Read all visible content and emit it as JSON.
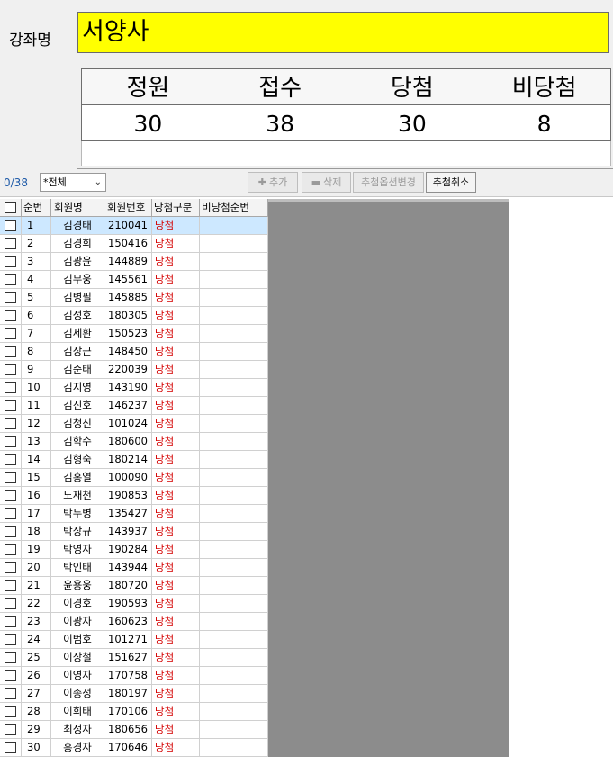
{
  "course": {
    "label": "강좌명",
    "name": "서양사"
  },
  "stats": {
    "headers": [
      "정원",
      "접수",
      "당첨",
      "비당첨"
    ],
    "values": [
      "30",
      "38",
      "30",
      "8"
    ]
  },
  "toolbar": {
    "count": "0/38",
    "filter_value": "*전체",
    "add_label": "추가",
    "delete_label": "삭제",
    "change_option_label": "추첨옵션변경",
    "cancel_draw_label": "추첨취소"
  },
  "table": {
    "columns": [
      "순번",
      "회원명",
      "회원번호",
      "당첨구분",
      "비당첨순번"
    ],
    "rows": [
      {
        "no": "1",
        "name": "김경태",
        "id": "210041",
        "status": "당첨",
        "rank": ""
      },
      {
        "no": "2",
        "name": "김경희",
        "id": "150416",
        "status": "당첨",
        "rank": ""
      },
      {
        "no": "3",
        "name": "김광윤",
        "id": "144889",
        "status": "당첨",
        "rank": ""
      },
      {
        "no": "4",
        "name": "김무웅",
        "id": "145561",
        "status": "당첨",
        "rank": ""
      },
      {
        "no": "5",
        "name": "김병필",
        "id": "145885",
        "status": "당첨",
        "rank": ""
      },
      {
        "no": "6",
        "name": "김성호",
        "id": "180305",
        "status": "당첨",
        "rank": ""
      },
      {
        "no": "7",
        "name": "김세환",
        "id": "150523",
        "status": "당첨",
        "rank": ""
      },
      {
        "no": "8",
        "name": "김장근",
        "id": "148450",
        "status": "당첨",
        "rank": ""
      },
      {
        "no": "9",
        "name": "김준태",
        "id": "220039",
        "status": "당첨",
        "rank": ""
      },
      {
        "no": "10",
        "name": "김지영",
        "id": "143190",
        "status": "당첨",
        "rank": ""
      },
      {
        "no": "11",
        "name": "김진호",
        "id": "146237",
        "status": "당첨",
        "rank": ""
      },
      {
        "no": "12",
        "name": "김청진",
        "id": "101024",
        "status": "당첨",
        "rank": ""
      },
      {
        "no": "13",
        "name": "김학수",
        "id": "180600",
        "status": "당첨",
        "rank": ""
      },
      {
        "no": "14",
        "name": "김형숙",
        "id": "180214",
        "status": "당첨",
        "rank": ""
      },
      {
        "no": "15",
        "name": "김홍열",
        "id": "100090",
        "status": "당첨",
        "rank": ""
      },
      {
        "no": "16",
        "name": "노재천",
        "id": "190853",
        "status": "당첨",
        "rank": ""
      },
      {
        "no": "17",
        "name": "박두병",
        "id": "135427",
        "status": "당첨",
        "rank": ""
      },
      {
        "no": "18",
        "name": "박상규",
        "id": "143937",
        "status": "당첨",
        "rank": ""
      },
      {
        "no": "19",
        "name": "박영자",
        "id": "190284",
        "status": "당첨",
        "rank": ""
      },
      {
        "no": "20",
        "name": "박인태",
        "id": "143944",
        "status": "당첨",
        "rank": ""
      },
      {
        "no": "21",
        "name": "윤용웅",
        "id": "180720",
        "status": "당첨",
        "rank": ""
      },
      {
        "no": "22",
        "name": "이경호",
        "id": "190593",
        "status": "당첨",
        "rank": ""
      },
      {
        "no": "23",
        "name": "이광자",
        "id": "160623",
        "status": "당첨",
        "rank": ""
      },
      {
        "no": "24",
        "name": "이범호",
        "id": "101271",
        "status": "당첨",
        "rank": ""
      },
      {
        "no": "25",
        "name": "이상철",
        "id": "151627",
        "status": "당첨",
        "rank": ""
      },
      {
        "no": "26",
        "name": "이영자",
        "id": "170758",
        "status": "당첨",
        "rank": ""
      },
      {
        "no": "27",
        "name": "이종성",
        "id": "180197",
        "status": "당첨",
        "rank": ""
      },
      {
        "no": "28",
        "name": "이희태",
        "id": "170106",
        "status": "당첨",
        "rank": ""
      },
      {
        "no": "29",
        "name": "최정자",
        "id": "180656",
        "status": "당첨",
        "rank": ""
      },
      {
        "no": "30",
        "name": "홍경자",
        "id": "170646",
        "status": "당첨",
        "rank": ""
      }
    ]
  },
  "colors": {
    "course_bg": "#ffff00",
    "win_text": "#d40000",
    "selected_row": "#cde8ff",
    "panel_gray": "#8c8c8c"
  },
  "icons": {
    "add": "plus-icon",
    "delete": "minus-icon",
    "filter": "chevron-down-icon"
  }
}
